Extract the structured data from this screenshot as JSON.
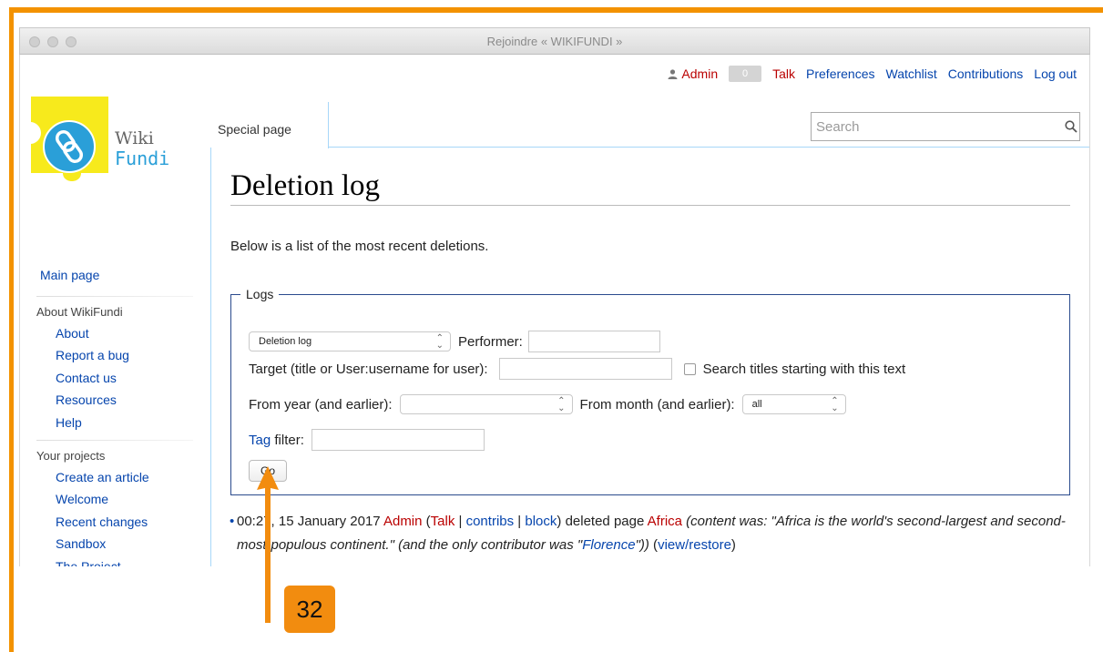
{
  "window": {
    "title": "Rejoindre « WIKIFUNDI »"
  },
  "user_links": {
    "username": "Admin",
    "notifications": "0",
    "talk": "Talk",
    "preferences": "Preferences",
    "watchlist": "Watchlist",
    "contributions": "Contributions",
    "logout": "Log out"
  },
  "logo": {
    "line1": "Wiki",
    "line2": "Fundi"
  },
  "sidebar": {
    "main_page": "Main page",
    "about_heading": "About WikiFundi",
    "about_items": [
      "About",
      "Report a bug",
      "Contact us",
      "Resources",
      "Help"
    ],
    "projects_heading": "Your projects",
    "projects_items": [
      "Create an article",
      "Welcome",
      "Recent changes",
      "Sandbox",
      "The Project"
    ]
  },
  "tabs": {
    "special": "Special page"
  },
  "search": {
    "placeholder": "Search"
  },
  "content": {
    "title": "Deletion log",
    "intro": "Below is a list of the most recent deletions.",
    "form": {
      "legend": "Logs",
      "log_type_selected": "Deletion log",
      "performer_label": "Performer:",
      "target_label": "Target (title or User:username for user):",
      "prefix_checkbox_label": "Search titles starting with this text",
      "year_label": "From year (and earlier):",
      "month_label": "From month (and earlier):",
      "month_selected": "all",
      "tag_link": "Tag",
      "tag_label": " filter:",
      "go_button": "Go"
    },
    "log_entry": {
      "time_date": "00:27, 15 January 2017",
      "user": "Admin",
      "talk": "Talk",
      "contribs": "contribs",
      "block": "block",
      "action": "deleted page",
      "page": "Africa",
      "content_prefix": "(content was: \"Africa is the world's second-largest and second-most-populous continent.\" (and the only contributor was \"",
      "contributor": "Florence",
      "content_suffix": "\"))",
      "view_restore": "view/restore"
    }
  },
  "annotation": {
    "step": "32",
    "color": "#f28c0f"
  }
}
